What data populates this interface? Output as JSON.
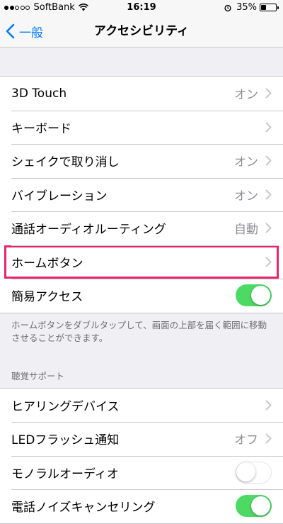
{
  "status_bar": {
    "carrier": "SoftBank",
    "time": "16:19",
    "battery_percent": "35%",
    "battery_level": 0.35,
    "signal_bars_filled": 2,
    "signal_bars_total": 5
  },
  "nav": {
    "back_label": "一般",
    "title": "アクセシビリティ"
  },
  "colors": {
    "accent": "#007aff",
    "toggle_on": "#4cd964",
    "highlight": "#e6266a"
  },
  "group1": {
    "rows": [
      {
        "label": "3D Touch",
        "value": "オン"
      },
      {
        "label": "キーボード",
        "value": ""
      },
      {
        "label": "シェイクで取り消し",
        "value": "オン"
      },
      {
        "label": "バイブレーション",
        "value": "オン"
      },
      {
        "label": "通話オーディオルーティング",
        "value": "自動"
      },
      {
        "label": "ホームボタン",
        "value": ""
      },
      {
        "label": "簡易アクセス",
        "toggle": true
      }
    ],
    "footer": "ホームボタンをダブルタップして、画面の上部を届く範囲に移動させることができます。"
  },
  "group2": {
    "header": "聴覚サポート",
    "rows": [
      {
        "label": "ヒアリングデバイス",
        "value": ""
      },
      {
        "label": "LEDフラッシュ通知",
        "value": "オフ"
      },
      {
        "label": "モノラルオーディオ",
        "toggle": false
      },
      {
        "label": "電話ノイズキャンセリング",
        "toggle": true
      }
    ]
  }
}
